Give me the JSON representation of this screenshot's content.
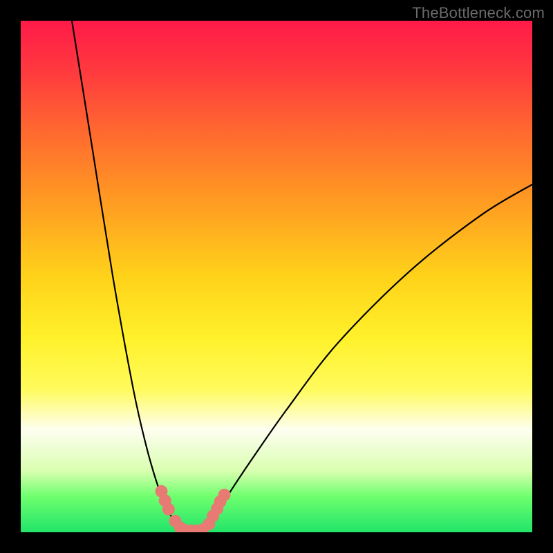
{
  "watermark": "TheBottleneck.com",
  "chart_data": {
    "type": "line",
    "title": "",
    "xlabel": "",
    "ylabel": "",
    "xlim": [
      0,
      100
    ],
    "ylim": [
      0,
      100
    ],
    "background_gradient": {
      "top": "#ff1a49",
      "upper_mid": "#ff9a22",
      "mid": "#fff12a",
      "lower_mid": "#fdfef0",
      "bottom": "#22e46a"
    },
    "series": [
      {
        "name": "left-curve",
        "stroke": "#000000",
        "x": [
          10,
          14,
          18,
          22,
          24.5,
          26.5,
          28,
          29.5,
          31.5
        ],
        "y": [
          100,
          75,
          50,
          28,
          17,
          10,
          6,
          3,
          0.5
        ]
      },
      {
        "name": "right-curve",
        "stroke": "#000000",
        "x": [
          36,
          38.5,
          41,
          45,
          52,
          62,
          76,
          90,
          100
        ],
        "y": [
          0.5,
          4,
          8,
          14,
          24,
          37,
          51,
          62,
          68
        ]
      },
      {
        "name": "valley-floor",
        "stroke": "#000000",
        "x": [
          31.5,
          33.5,
          36
        ],
        "y": [
          0.5,
          0.3,
          0.5
        ]
      },
      {
        "name": "pink-markers-left",
        "stroke": "#e87a74",
        "type": "scatter",
        "x": [
          27.5,
          28.2,
          28.9,
          30.2,
          31.2
        ],
        "y": [
          8.0,
          6.2,
          4.5,
          2.2,
          0.9
        ]
      },
      {
        "name": "pink-markers-right",
        "stroke": "#e87a74",
        "type": "scatter",
        "x": [
          36.8,
          37.6,
          38.4,
          39.0,
          39.8
        ],
        "y": [
          1.6,
          3.2,
          4.6,
          6.0,
          7.3
        ]
      },
      {
        "name": "pink-markers-bottom",
        "stroke": "#e87a74",
        "type": "scatter",
        "x": [
          32.2,
          33.3,
          34.4,
          35.5
        ],
        "y": [
          0.4,
          0.3,
          0.3,
          0.5
        ]
      }
    ]
  }
}
